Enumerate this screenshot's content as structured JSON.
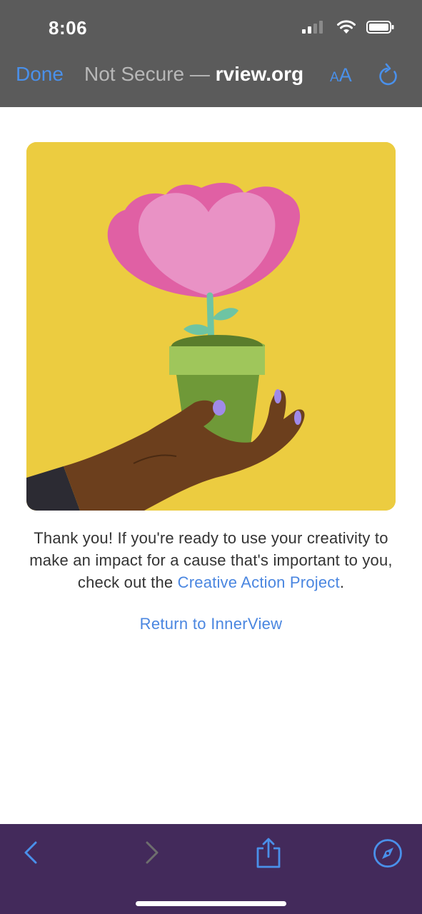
{
  "status_bar": {
    "time": "8:06"
  },
  "browser_nav": {
    "done_label": "Done",
    "url_prefix": "Not Secure — ",
    "url_domain": "rview.org",
    "text_size_small": "A",
    "text_size_large": "A",
    "reload_icon": "reload-icon"
  },
  "content": {
    "message_before_link": "Thank you! If you're ready to use your creativity to make an impact for a cause that's important to you, check out the ",
    "link_text": "Creative Action Project",
    "message_after_link": ".",
    "return_link": "Return to InnerView"
  },
  "toolbar": {
    "icons": [
      "back-icon",
      "forward-icon",
      "share-icon",
      "compass-icon"
    ]
  },
  "colors": {
    "top_bar": "#5b5b5b",
    "accent_blue": "#4a90ea",
    "hero_background": "#eccc40",
    "bottom_bar": "#432a5b"
  }
}
